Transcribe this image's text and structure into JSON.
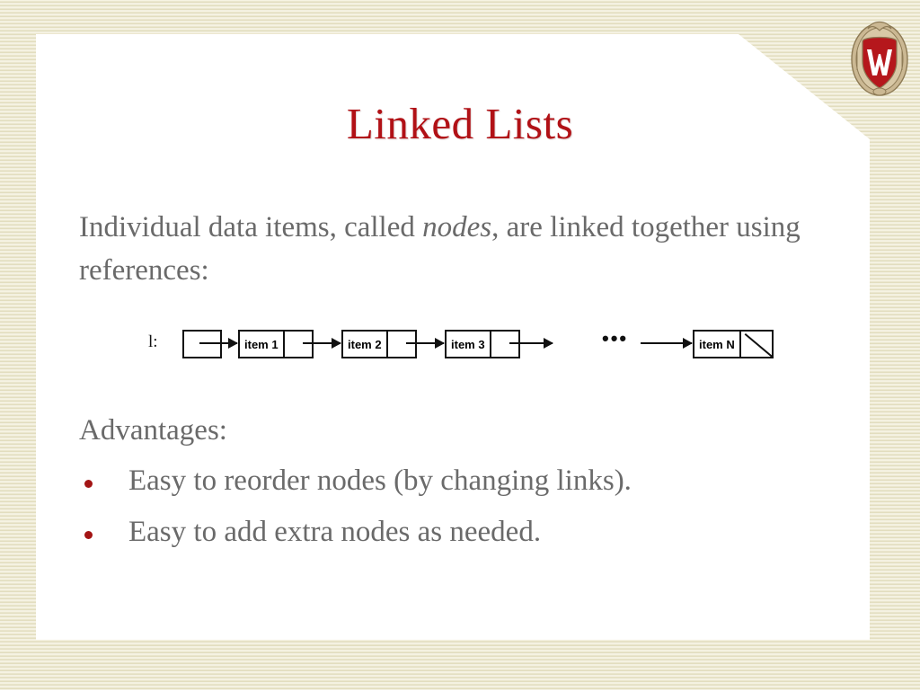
{
  "slide": {
    "title": "Linked Lists",
    "title_color": "#b11116",
    "body_text_color": "#6a6a6a",
    "bullet_color": "#a31515",
    "panel_color": "#ffffff",
    "background_color": "#efecd8"
  },
  "logo": {
    "name": "uw-madison-crest",
    "letter": "W",
    "shield_color": "#b5171c",
    "frame_color": "#c8b48c"
  },
  "intro": {
    "part1": "Individual data items, called ",
    "emphasis": "nodes",
    "part2": ", are linked together using references:"
  },
  "diagram": {
    "label": "l:",
    "nodes": [
      {
        "text": "",
        "type": "head"
      },
      {
        "text": "item 1",
        "type": "node"
      },
      {
        "text": "item 2",
        "type": "node"
      },
      {
        "text": "item 3",
        "type": "node"
      },
      {
        "text": "item N",
        "type": "null-terminated"
      }
    ],
    "ellipsis": "•••"
  },
  "advantages": {
    "heading": "Advantages:",
    "items": [
      "Easy to reorder nodes (by changing links).",
      "Easy to add extra nodes as needed."
    ]
  }
}
